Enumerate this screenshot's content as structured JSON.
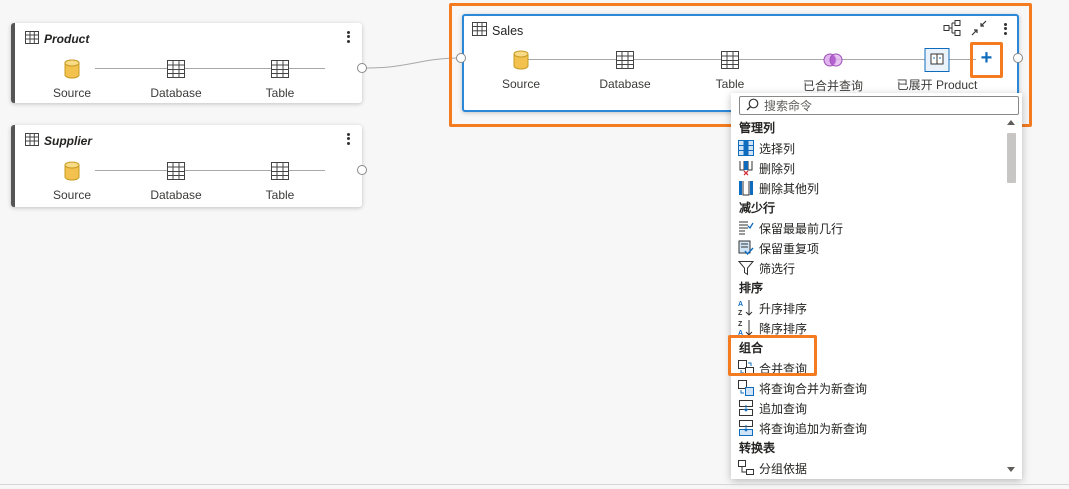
{
  "queries": [
    {
      "title": "Product",
      "steps": [
        "Source",
        "Database",
        "Table"
      ]
    },
    {
      "title": "Supplier",
      "steps": [
        "Source",
        "Database",
        "Table"
      ]
    },
    {
      "title": "Sales",
      "steps": [
        "Source",
        "Database",
        "Table",
        "已合并查询",
        "已展开 Product"
      ]
    }
  ],
  "sales_actions": {
    "add_step_symbol": "+"
  },
  "menu": {
    "search_placeholder": "搜索命令",
    "sections": [
      {
        "title": "管理列",
        "items": [
          {
            "label": "选择列",
            "icon": "choose-columns-icon"
          },
          {
            "label": "删除列",
            "icon": "remove-columns-icon"
          },
          {
            "label": "删除其他列",
            "icon": "remove-other-columns-icon"
          }
        ]
      },
      {
        "title": "减少行",
        "items": [
          {
            "label": "保留最最前几行",
            "icon": "keep-top-rows-icon"
          },
          {
            "label": "保留重复项",
            "icon": "keep-duplicates-icon"
          },
          {
            "label": "筛选行",
            "icon": "filter-icon"
          }
        ]
      },
      {
        "title": "排序",
        "items": [
          {
            "label": "升序排序",
            "icon": "sort-ascending-icon"
          },
          {
            "label": "降序排序",
            "icon": "sort-descending-icon"
          }
        ]
      },
      {
        "title": "组合",
        "items": [
          {
            "label": "合并查询",
            "icon": "merge-queries-icon"
          },
          {
            "label": "将查询合并为新查询",
            "icon": "merge-as-new-icon"
          },
          {
            "label": "追加查询",
            "icon": "append-queries-icon"
          },
          {
            "label": "将查询追加为新查询",
            "icon": "append-as-new-icon"
          }
        ]
      },
      {
        "title": "转换表",
        "items": [
          {
            "label": "分组依据",
            "icon": "group-by-icon"
          }
        ]
      }
    ]
  },
  "colors": {
    "highlight": "#f47b20",
    "selected_border": "#2b88d8",
    "accent_blue": "#0f6cbd",
    "source_yellow": "#f2c14e"
  }
}
